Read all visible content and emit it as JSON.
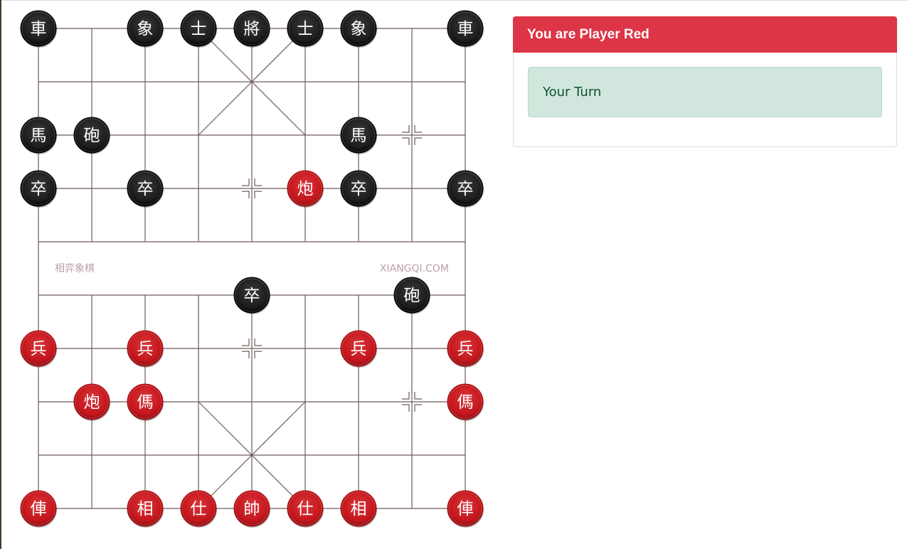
{
  "board": {
    "watermark_left": "相弈象棋",
    "watermark_right": "XIANGQI.COM",
    "colors": {
      "grid_line": "#6f5a5a",
      "red_piece": "#c4161c",
      "black_piece": "#1c1c1c",
      "piece_text": "#ffffff"
    },
    "pieces": [
      {
        "side": "black",
        "char": "車",
        "file": 0,
        "rank": 0
      },
      {
        "side": "black",
        "char": "象",
        "file": 2,
        "rank": 0
      },
      {
        "side": "black",
        "char": "士",
        "file": 3,
        "rank": 0
      },
      {
        "side": "black",
        "char": "將",
        "file": 4,
        "rank": 0
      },
      {
        "side": "black",
        "char": "士",
        "file": 5,
        "rank": 0
      },
      {
        "side": "black",
        "char": "象",
        "file": 6,
        "rank": 0
      },
      {
        "side": "black",
        "char": "車",
        "file": 8,
        "rank": 0
      },
      {
        "side": "black",
        "char": "馬",
        "file": 0,
        "rank": 2
      },
      {
        "side": "black",
        "char": "砲",
        "file": 1,
        "rank": 2
      },
      {
        "side": "black",
        "char": "馬",
        "file": 6,
        "rank": 2
      },
      {
        "side": "black",
        "char": "卒",
        "file": 0,
        "rank": 3
      },
      {
        "side": "black",
        "char": "卒",
        "file": 2,
        "rank": 3
      },
      {
        "side": "red",
        "char": "炮",
        "file": 5,
        "rank": 3
      },
      {
        "side": "black",
        "char": "卒",
        "file": 6,
        "rank": 3
      },
      {
        "side": "black",
        "char": "卒",
        "file": 8,
        "rank": 3
      },
      {
        "side": "black",
        "char": "卒",
        "file": 4,
        "rank": 5
      },
      {
        "side": "black",
        "char": "砲",
        "file": 7,
        "rank": 5
      },
      {
        "side": "red",
        "char": "兵",
        "file": 0,
        "rank": 6
      },
      {
        "side": "red",
        "char": "兵",
        "file": 2,
        "rank": 6
      },
      {
        "side": "red",
        "char": "兵",
        "file": 6,
        "rank": 6
      },
      {
        "side": "red",
        "char": "兵",
        "file": 8,
        "rank": 6
      },
      {
        "side": "red",
        "char": "炮",
        "file": 1,
        "rank": 7
      },
      {
        "side": "red",
        "char": "傌",
        "file": 2,
        "rank": 7
      },
      {
        "side": "red",
        "char": "傌",
        "file": 8,
        "rank": 7
      },
      {
        "side": "red",
        "char": "俥",
        "file": 0,
        "rank": 9
      },
      {
        "side": "red",
        "char": "相",
        "file": 2,
        "rank": 9
      },
      {
        "side": "red",
        "char": "仕",
        "file": 3,
        "rank": 9
      },
      {
        "side": "red",
        "char": "帥",
        "file": 4,
        "rank": 9
      },
      {
        "side": "red",
        "char": "仕",
        "file": 5,
        "rank": 9
      },
      {
        "side": "red",
        "char": "相",
        "file": 6,
        "rank": 9
      },
      {
        "side": "red",
        "char": "俥",
        "file": 8,
        "rank": 9
      }
    ],
    "markers": [
      {
        "file": 7,
        "rank": 2
      },
      {
        "file": 4,
        "rank": 3
      },
      {
        "file": 4,
        "rank": 6
      },
      {
        "file": 7,
        "rank": 7
      }
    ]
  },
  "panel": {
    "header": "You are Player Red",
    "status": "Your Turn",
    "header_color": "#dc3545",
    "status_bg": "#d1e7dd"
  }
}
